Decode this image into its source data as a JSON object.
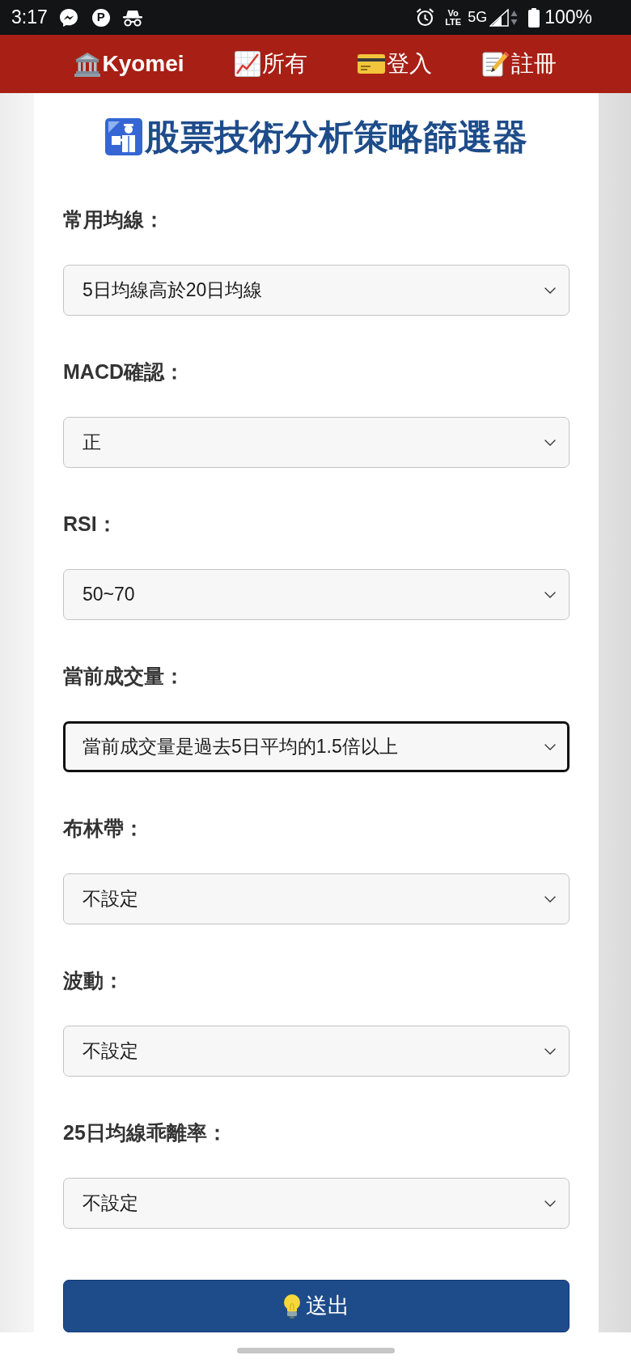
{
  "status_bar": {
    "time": "3:17",
    "notification_badge": "P",
    "volte": [
      "Vo",
      "LTE"
    ],
    "network": "5G",
    "battery": "100%"
  },
  "nav": {
    "items": [
      {
        "label": "Kyomei",
        "kind": "brand"
      },
      {
        "label": "所有",
        "kind": "link"
      },
      {
        "label": "登入",
        "kind": "link"
      },
      {
        "label": "註冊",
        "kind": "link"
      }
    ]
  },
  "page": {
    "title": "股票技術分析策略篩選器"
  },
  "form": {
    "fields": [
      {
        "label": "常用均線：",
        "value": "5日均線高於20日均線",
        "focused": false
      },
      {
        "label": "MACD確認：",
        "value": "正",
        "focused": false
      },
      {
        "label": "RSI：",
        "value": "50~70",
        "focused": false
      },
      {
        "label": "當前成交量：",
        "value": "當前成交量是過去5日平均的1.5倍以上",
        "focused": true
      },
      {
        "label": "布林帶：",
        "value": "不設定",
        "focused": false
      },
      {
        "label": "波動：",
        "value": "不設定",
        "focused": false
      },
      {
        "label": "25日均線乖離率：",
        "value": "不設定",
        "focused": false
      }
    ],
    "submit": {
      "label": "送出"
    }
  }
}
